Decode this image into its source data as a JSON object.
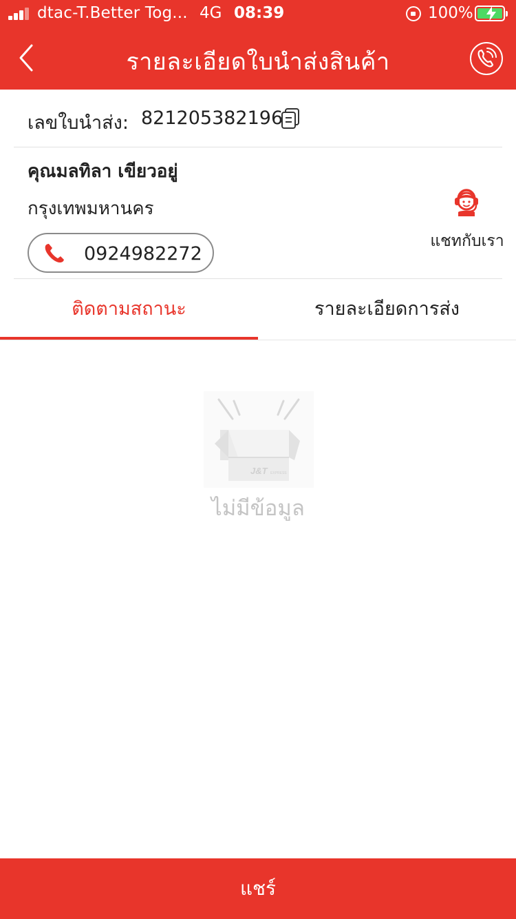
{
  "status_bar": {
    "carrier": "dtac-T.Better Tog...",
    "network": "4G",
    "time": "08:39",
    "battery": "100%"
  },
  "nav": {
    "title": "รายละเอียดใบนำส่งสินค้า",
    "back_icon": "chevron-left-icon",
    "call_icon": "phone-call-icon"
  },
  "waybill": {
    "label": "เลขใบนำส่ง:",
    "number": "821205382196",
    "copy_icon": "copy-icon"
  },
  "recipient": {
    "name": "คุณมลทิลา เขียวอยู่",
    "city": "กรุงเทพมหานคร",
    "phone": "0924982272"
  },
  "chat": {
    "label": "แชทกับเรา",
    "icon": "customer-service-icon"
  },
  "tabs": [
    {
      "label": "ติดตามสถานะ",
      "active": true
    },
    {
      "label": "รายละเอียดการส่ง",
      "active": false
    }
  ],
  "empty_state": {
    "text": "ไม่มีข้อมูล",
    "logo_text": "J&T",
    "logo_sub": "EXPRESS"
  },
  "footer": {
    "share_label": "แชร์"
  },
  "colors": {
    "brand": "#e8352b",
    "battery": "#4cd964",
    "muted": "#c4c4c4"
  }
}
